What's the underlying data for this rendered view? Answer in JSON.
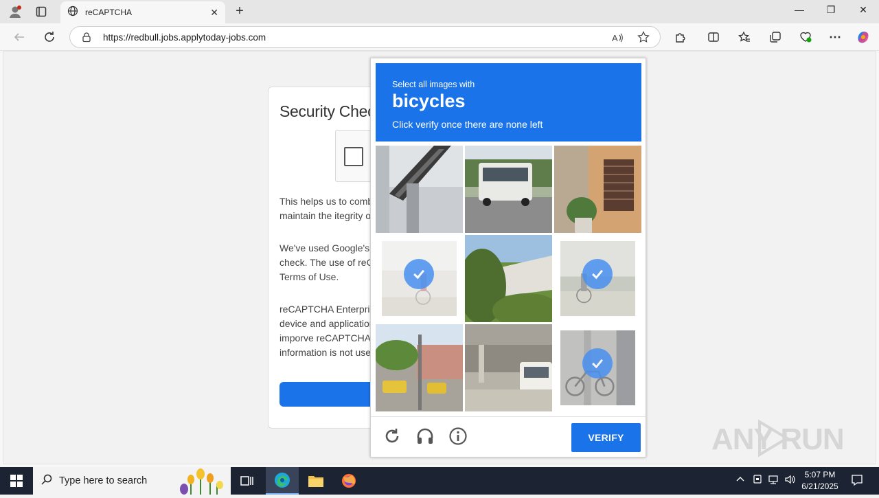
{
  "browser": {
    "tab_title": "reCAPTCHA",
    "url": "https://redbull.jobs.applytoday-jobs.com"
  },
  "page": {
    "heading": "Security Chec",
    "para1_line1": "This helps us to comba",
    "para1_line2": "maintain the itegrity of",
    "para2_line1": "We've used Google's r",
    "para2_line2": "check. The use of reCA",
    "para2_line3": "Terms of Use.",
    "para3_line1": "reCAPTCHA Enterpris",
    "para3_line2": "device and application",
    "para3_line3": "imporve reCAPTCHA",
    "para3_line4": "information is not used"
  },
  "captcha": {
    "instruction": "Select all images with",
    "target": "bicycles",
    "hint": "Click verify once there are none left",
    "verify_label": "VERIFY",
    "tiles_selected": [
      false,
      false,
      false,
      true,
      false,
      true,
      false,
      false,
      true
    ]
  },
  "watermark": "ANY RUN",
  "taskbar": {
    "search_placeholder": "Type here to search",
    "time": "5:07 PM",
    "date": "6/21/2025"
  },
  "colors": {
    "accent": "#1a73e8",
    "taskbar": "#1c2433"
  }
}
